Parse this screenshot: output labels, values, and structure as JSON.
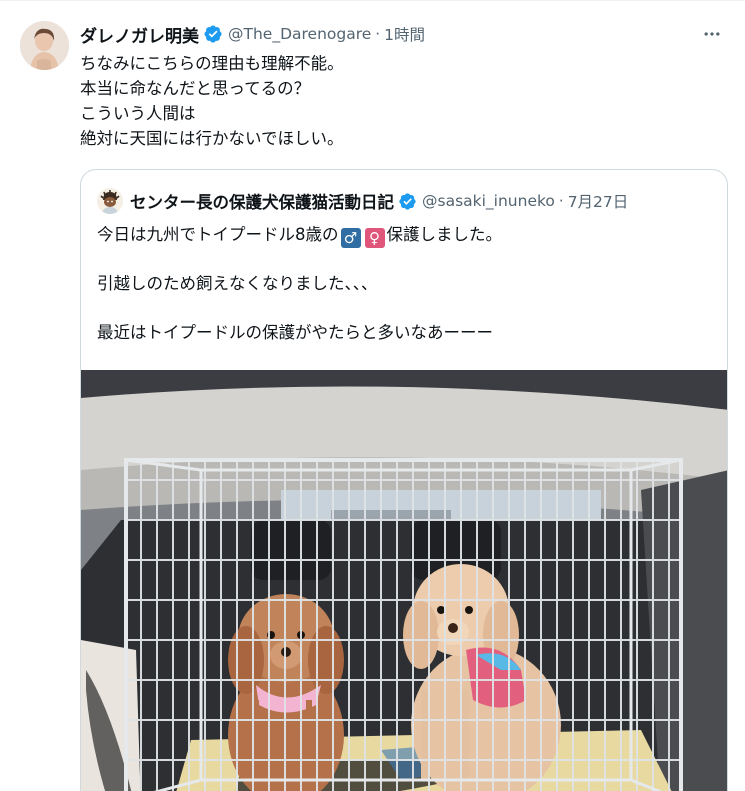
{
  "tweet": {
    "display_name": "ダレノガレ明美",
    "handle": "@The_Darenogare",
    "separator": "·",
    "time": "1時間",
    "text_lines": [
      "ちなみにこちらの理由も理解不能。",
      "本当に命なんだと思ってるの？",
      "こういう人間は",
      "絶対に天国には行かないでほしい。"
    ],
    "more_icon": "more-horizontal-icon",
    "verified_icon": "verified-badge-icon"
  },
  "quote": {
    "display_name": "センター長の保護犬保護猫活動日記",
    "handle": "@sasaki_inuneko",
    "separator": "·",
    "date": "7月27日",
    "line1_before": "今日は九州でトイプードル8歳の",
    "male_symbol": "♂",
    "female_symbol": "♀",
    "line1_after": "保護しました。",
    "line2": "引越しのため飼えなくなりました、、、",
    "line3": "最近はトイプードルの保護がやたらと多いなあーーー",
    "image_alt": "photo-two-poodles-in-cage",
    "colors": {
      "male_emoji": "#2f6da3",
      "female_emoji": "#e0567a"
    }
  },
  "colors": {
    "text": "#0f1419",
    "secondary": "#536471",
    "border": "#cfd9de",
    "verified": "#1d9bf0"
  }
}
